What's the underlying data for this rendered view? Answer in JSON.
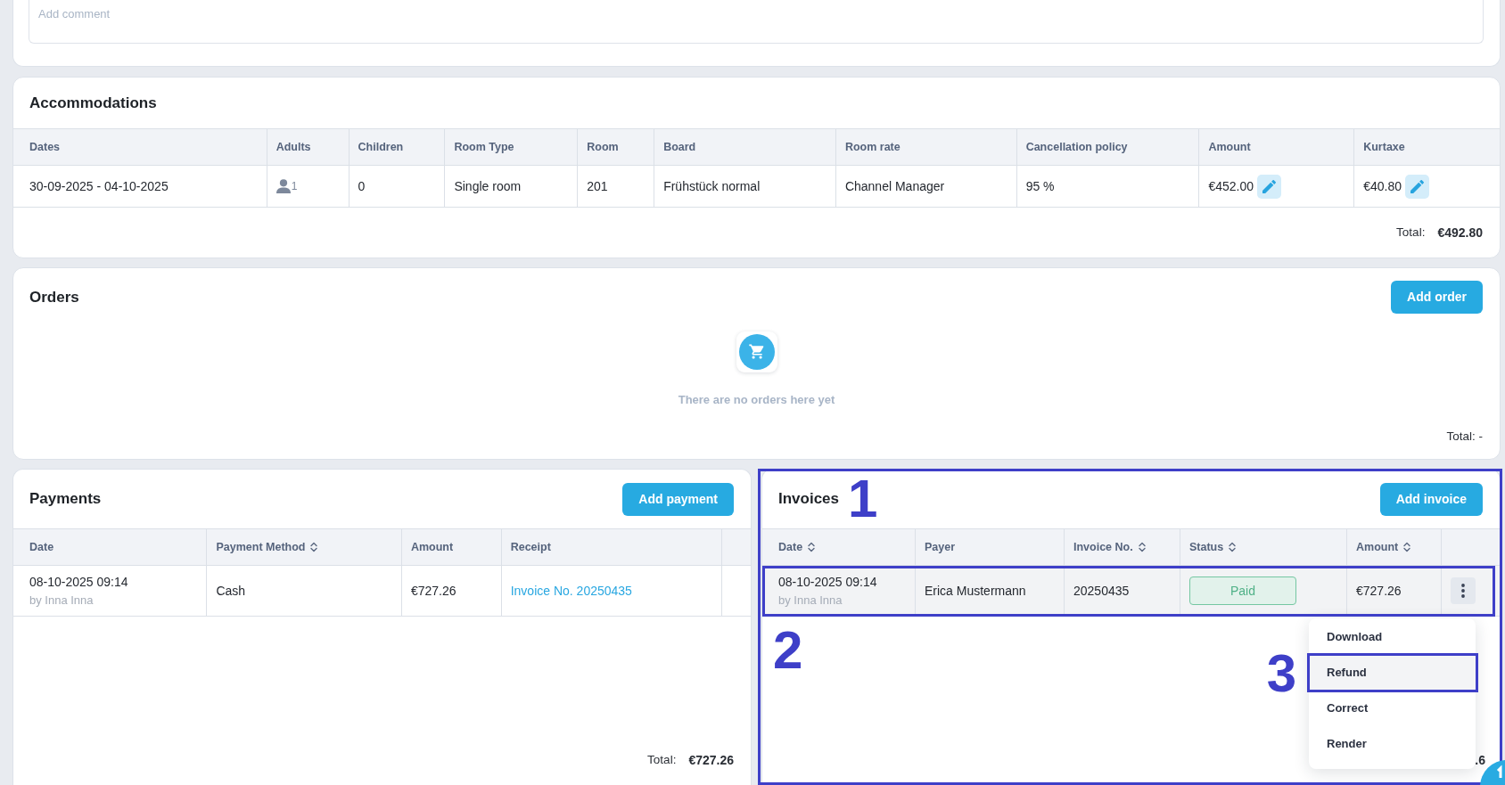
{
  "comment": {
    "placeholder": "Add comment"
  },
  "accommodations": {
    "title": "Accommodations",
    "columns": [
      "Dates",
      "Adults",
      "Children",
      "Room Type",
      "Room",
      "Board",
      "Room rate",
      "Cancellation policy",
      "Amount",
      "Kurtaxe"
    ],
    "rows": [
      {
        "cells": [
          {
            "kind": "text",
            "text": "30-09-2025 - 04-10-2025"
          },
          {
            "kind": "guests",
            "text": "1"
          },
          {
            "kind": "text",
            "text": "0"
          },
          {
            "kind": "text",
            "text": "Single room"
          },
          {
            "kind": "text",
            "text": "201"
          },
          {
            "kind": "text",
            "text": "Frühstück normal"
          },
          {
            "kind": "text",
            "text": "Channel Manager"
          },
          {
            "kind": "text",
            "text": "95 %"
          },
          {
            "kind": "editable",
            "text": "€452.00"
          },
          {
            "kind": "editable",
            "text": "€40.80"
          }
        ]
      }
    ],
    "total_label": "Total:",
    "total_value": "€492.80"
  },
  "orders": {
    "title": "Orders",
    "add_button": "Add order",
    "empty_text": "There are no orders here yet",
    "total": "Total: -"
  },
  "payments": {
    "title": "Payments",
    "add_button": "Add payment",
    "columns": [
      {
        "label": "Date",
        "sortable": false
      },
      {
        "label": "Payment Method",
        "sortable": true
      },
      {
        "label": "Amount",
        "sortable": false
      },
      {
        "label": "Receipt",
        "sortable": false
      }
    ],
    "rows": [
      {
        "date": "08-10-2025 09:14",
        "author": "by Inna Inna",
        "method": "Cash",
        "amount": "€727.26",
        "receipt": "Invoice No. 20250435"
      }
    ],
    "total_label": "Total:",
    "total_value": "€727.26"
  },
  "invoices": {
    "title": "Invoices",
    "annotation": "1",
    "add_button": "Add invoice",
    "columns": [
      {
        "label": "Date",
        "sortable": true
      },
      {
        "label": "Payer",
        "sortable": false
      },
      {
        "label": "Invoice No.",
        "sortable": true
      },
      {
        "label": "Status",
        "sortable": true
      },
      {
        "label": "Amount",
        "sortable": true
      }
    ],
    "rows": [
      {
        "date": "08-10-2025 09:14",
        "author": "by Inna Inna",
        "payer": "Erica Mustermann",
        "number": "20250435",
        "status": {
          "text": "Paid",
          "kind": "paid"
        },
        "amount": "€727.26",
        "highlighted": true,
        "annotation": "2",
        "menu_open": true
      }
    ],
    "menu": {
      "items": [
        {
          "label": "Download",
          "selected": false
        },
        {
          "label": "Refund",
          "selected": true,
          "annotation": "3"
        },
        {
          "label": "Correct",
          "selected": false
        },
        {
          "label": "Render",
          "selected": false
        }
      ]
    },
    "total_visible": ".6"
  }
}
